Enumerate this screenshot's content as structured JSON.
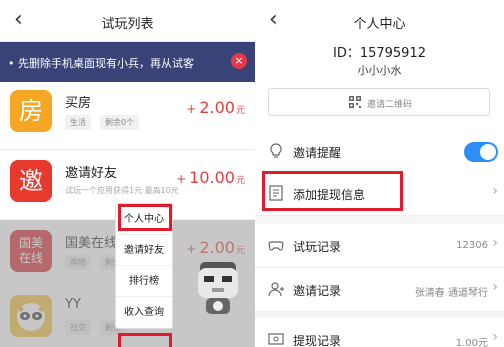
{
  "left": {
    "title": "试玩列表",
    "back_glyph": "‹",
    "banner": {
      "text": "• 先删除手机桌面现有小兵，再从试客",
      "close_glyph": "×"
    },
    "tasks": [
      {
        "icon_text": "房",
        "icon_color": "#f5a623",
        "name": "买房",
        "tags": [
          "生活",
          "剩余0个"
        ],
        "sub": "",
        "price": "2.00",
        "unit": "元"
      },
      {
        "icon_text": "邀",
        "icon_color": "#e8392f",
        "name": "邀请好友",
        "tags": [],
        "sub": "试玩一个应用获得1元 最高10元",
        "price": "10.00",
        "unit": "元"
      },
      {
        "icon_text": "国美\n在线",
        "icon_color": "#d7262e",
        "name": "国美在线",
        "tags": [
          "购物",
          "剩余"
        ],
        "sub": "",
        "price": "2.00",
        "unit": "元"
      },
      {
        "icon_text": "YY",
        "icon_color": "#f4c134",
        "name": "YY",
        "tags": [
          "社交",
          "剩余"
        ],
        "sub": "",
        "price": "",
        "unit": ""
      }
    ],
    "plus_glyph": "+",
    "menu": [
      "个人中心",
      "邀请好友",
      "排行榜",
      "收入查询"
    ]
  },
  "right": {
    "title": "个人中心",
    "back_glyph": "‹",
    "uid": "ID：15795912",
    "username": "小小小水",
    "invite_label": "邀请二维码",
    "rows": [
      {
        "label": "邀请提醒",
        "value": "",
        "icon": "bulb-icon"
      },
      {
        "label": "添加提现信息",
        "value": "",
        "icon": "document-icon"
      },
      {
        "label": "试玩记录",
        "value": "12306",
        "icon": "gamepad-icon"
      },
      {
        "label": "邀请记录",
        "value": "张清春 通道琴行",
        "icon": "person-icon"
      },
      {
        "label": "提现记录",
        "value": "1.00元",
        "icon": "cash-icon"
      }
    ],
    "chev_glyph": "›"
  },
  "colors": {
    "accent_red": "#e01b2c",
    "price_red": "#e23f3f",
    "banner_bg": "#3a4378",
    "toggle_blue": "#2f8ef5"
  }
}
